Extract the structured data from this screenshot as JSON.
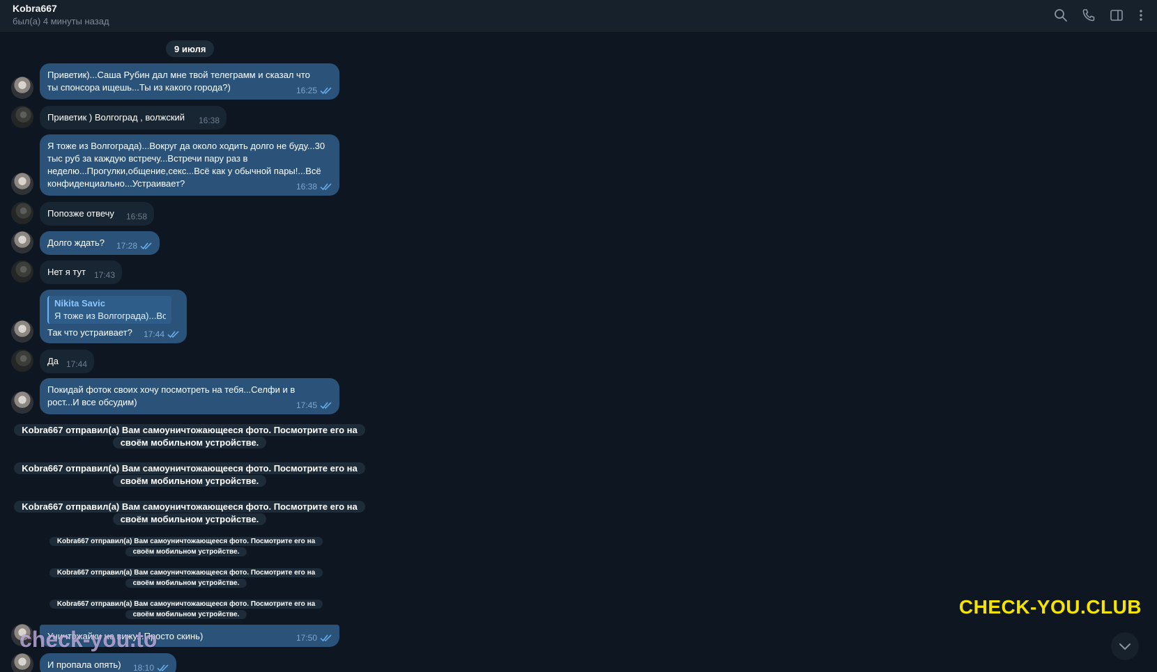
{
  "header": {
    "contact_name": "Kobra667",
    "status": "был(а) 4 минуты назад",
    "icons": [
      "search-icon",
      "phone-icon",
      "sidebar-toggle-icon",
      "more-vertical-icon"
    ]
  },
  "chat": {
    "date": "9 июля",
    "messages": [
      {
        "dir": "out",
        "text": "Приветик)...Саша Рубин дал мне твой телеграмм и сказал что ты спонсора ищешь...Ты из какого города?)",
        "time": "16:25"
      },
      {
        "dir": "in",
        "text": "Приветик ) Волгоград , волжский",
        "time": "16:38"
      },
      {
        "dir": "out",
        "text": "Я тоже из Волгограда)...Вокруг да около ходить долго не буду...30 тыс руб за каждую встречу...Встречи пару раз в неделю...Прогулки,общение,секс...Всё как у обычной пары!...Всё конфиденциально...Устраивает?",
        "time": "16:38"
      },
      {
        "dir": "in",
        "text": "Попозже отвечу",
        "time": "16:58"
      },
      {
        "dir": "out",
        "text": "Долго ждать?",
        "time": "17:28"
      },
      {
        "dir": "in",
        "text": "Нет я тут",
        "time": "17:43"
      },
      {
        "dir": "out",
        "reply_name": "Nikita Savic",
        "reply_text": "Я тоже из Волгограда)...Во...",
        "text": "Так что устраивает?",
        "time": "17:44"
      },
      {
        "dir": "in",
        "text": "Да",
        "time": "17:44"
      },
      {
        "dir": "out",
        "text": "Покидай фоток своих хочу посмотреть на тебя...Селфи и в рост...И все обсудим)",
        "time": "17:45"
      },
      {
        "dir": "out",
        "text": "Уничтожайки не вижу...Просто скинь)",
        "time": "17:50"
      },
      {
        "dir": "out",
        "text": "И пропала опять)",
        "time": "18:10"
      }
    ],
    "service_line1": "Kobra667 отправил(а) Вам самоуничтожающееся фото. Посмотрите его на",
    "service_line2": "своём мобильном устройстве."
  },
  "watermarks": {
    "top": "CHECK-YOU.CLUB",
    "bottom": "check-you.to"
  },
  "colors": {
    "background": "#0e1621",
    "header": "#17212b",
    "outgoing": "#2b5278",
    "incoming": "#182533",
    "accent": "#6ab2f2",
    "watermark": "#f5e400"
  }
}
